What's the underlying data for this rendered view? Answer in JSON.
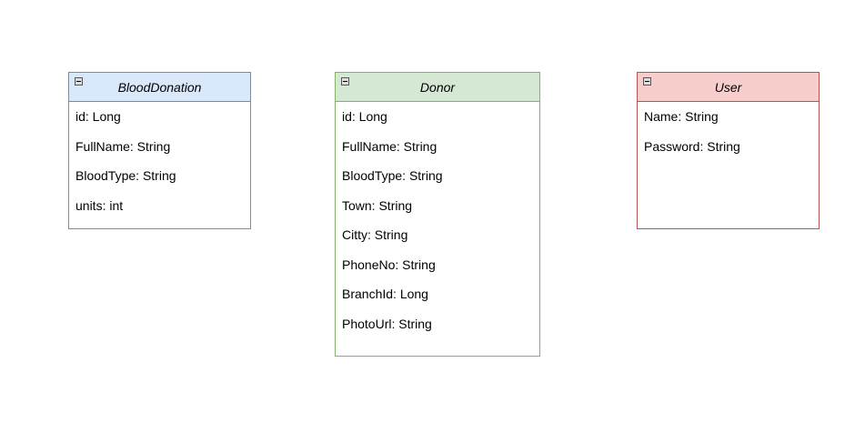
{
  "classes": {
    "blood_donation": {
      "name": "BloodDonation",
      "fill_color": "#dae8fc",
      "stroke_color": "#6c8ebf",
      "attributes": [
        "id: Long",
        "FullName: String",
        "BloodType: String",
        "units: int"
      ]
    },
    "donor": {
      "name": "Donor",
      "fill_color": "#d5e8d4",
      "stroke_color": "#82b366",
      "attributes": [
        "id: Long",
        "FullName: String",
        "BloodType: String",
        "Town: String",
        "Citty: String",
        "PhoneNo: String",
        "BranchId: Long",
        "PhotoUrl: String"
      ]
    },
    "user": {
      "name": "User",
      "fill_color": "#f8cecc",
      "stroke_color": "#b85450",
      "attributes": [
        "Name: String",
        "Password: String"
      ]
    }
  },
  "icons": {
    "collapse": "collapse-icon"
  }
}
